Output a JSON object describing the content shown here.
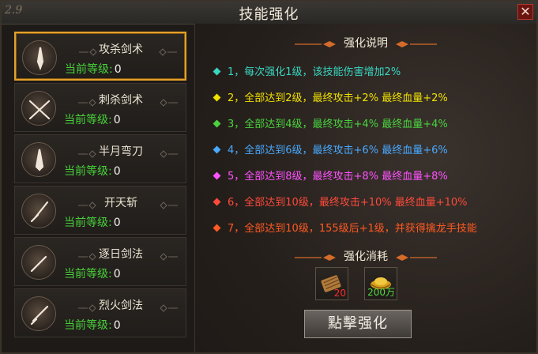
{
  "window": {
    "title": "技能强化",
    "logo_text": "2.9"
  },
  "skills": [
    {
      "name": "攻杀剑术",
      "level_label": "当前等级:",
      "level_value": "0",
      "selected": true
    },
    {
      "name": "刺杀剑术",
      "level_label": "当前等级:",
      "level_value": "0",
      "selected": false
    },
    {
      "name": "半月弯刀",
      "level_label": "当前等级:",
      "level_value": "0",
      "selected": false
    },
    {
      "name": "开天斩",
      "level_label": "当前等级:",
      "level_value": "0",
      "selected": false
    },
    {
      "name": "逐日剑法",
      "level_label": "当前等级:",
      "level_value": "0",
      "selected": false
    },
    {
      "name": "烈火剑法",
      "level_label": "当前等级:",
      "level_value": "0",
      "selected": false
    }
  ],
  "info": {
    "title": "强化说明",
    "lines": [
      {
        "text": "1，每次强化1级，该技能伤害增加2%",
        "color": "#39d6c2"
      },
      {
        "text": "2，全部达到2级，最终攻击+2%   最终血量+2%",
        "color": "#f0e000"
      },
      {
        "text": "3，全部达到4级，最终攻击+4%   最终血量+4%",
        "color": "#4ad23f"
      },
      {
        "text": "4，全部达到6级，最终攻击+6%   最终血量+6%",
        "color": "#48a9ff"
      },
      {
        "text": "5，全部达到8级，最终攻击+8%   最终血量+8%",
        "color": "#ff52ff"
      },
      {
        "text": "6，全部达到10级，最终攻击+10%  最终血量+10%",
        "color": "#ff4a3b"
      },
      {
        "text": "7，全部达到10级，155级后+1级，并获得擒龙手技能",
        "color": "#ff5a22"
      }
    ]
  },
  "cost": {
    "title": "强化消耗",
    "items": [
      {
        "name": "scroll-item",
        "qty": "20",
        "qty_color": "#ff2a2a"
      },
      {
        "name": "gold-ingot-item",
        "qty": "200万",
        "qty_color": "#56d640"
      }
    ]
  },
  "actions": {
    "upgrade_label": "點擊强化"
  }
}
